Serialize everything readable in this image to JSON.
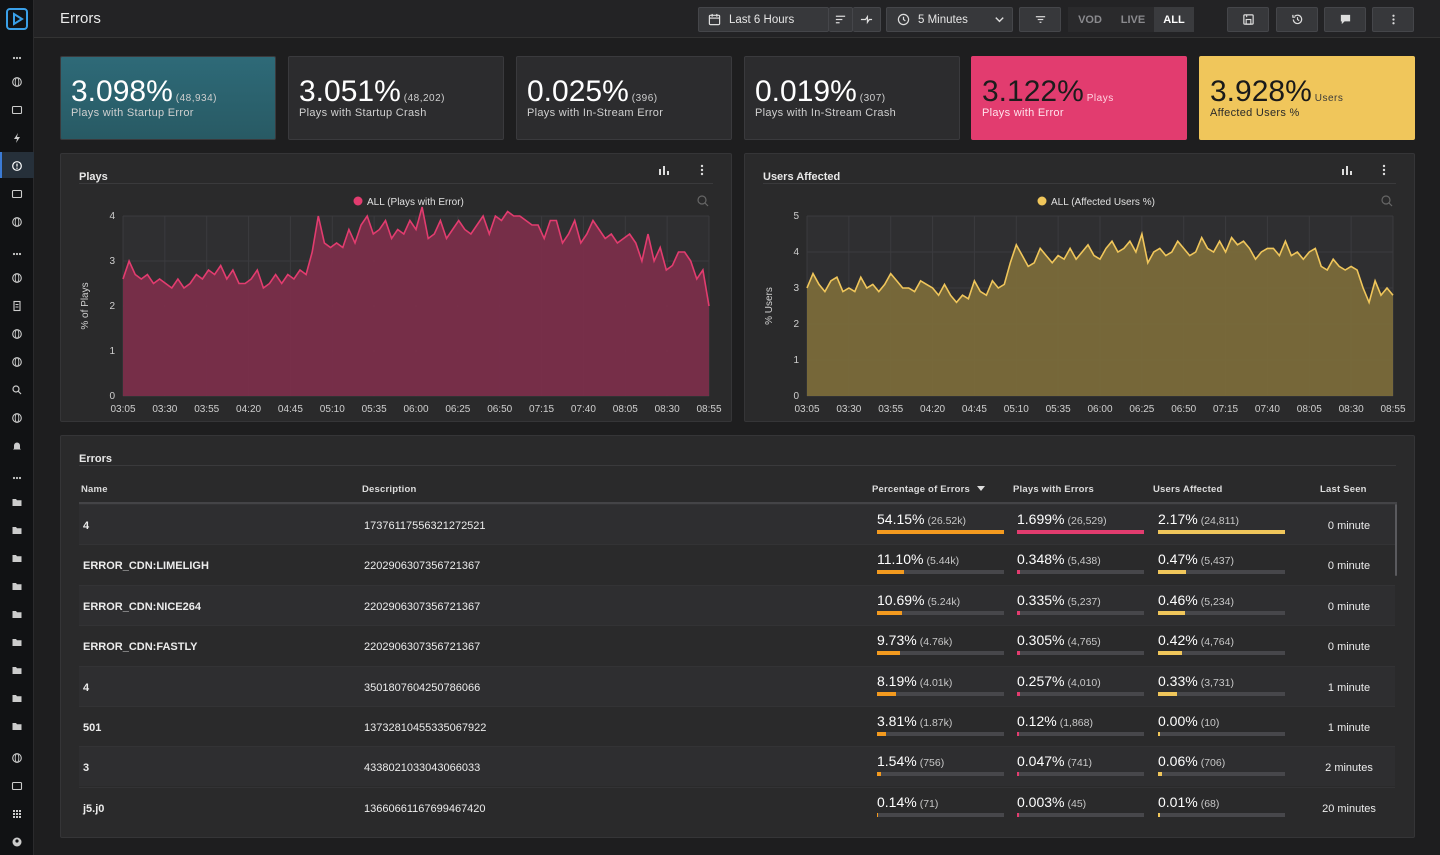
{
  "header": {
    "title": "Errors",
    "time_range": "Last 6 Hours",
    "interval": "5 Minutes",
    "modes": [
      "VOD",
      "LIVE",
      "ALL"
    ],
    "active_mode": "ALL"
  },
  "colors": {
    "accent": "#3b7bd6",
    "plays": "#e23c6f",
    "users": "#f0c65b",
    "bar_orange": "#f39a1f"
  },
  "kpis": [
    {
      "value": "3.098%",
      "count": "(48,934)",
      "label": "Plays with Startup Error",
      "bg": "#2c5f6a"
    },
    {
      "value": "3.051%",
      "count": "(48,202)",
      "label": "Plays with Startup Crash",
      "bg": "#2c2c2e"
    },
    {
      "value": "0.025%",
      "count": "(396)",
      "label": "Plays with In-Stream Error",
      "bg": "#2c2c2e"
    },
    {
      "value": "0.019%",
      "count": "(307)",
      "label": "Plays with In-Stream Crash",
      "bg": "#2c2c2e"
    },
    {
      "value": "3.122%",
      "count": "Plays",
      "label": "Plays with Error",
      "bg": "#e23c6f"
    },
    {
      "value": "3.928%",
      "count": "Users",
      "label": "Affected Users %",
      "bg": "#f0c65b"
    }
  ],
  "chart_data": [
    {
      "type": "area",
      "title": "Plays",
      "ylabel": "% of Plays",
      "legend": "ALL (Plays with Error)",
      "legend_position": "top-center",
      "color": "#e23c6f",
      "ylim": [
        0,
        4
      ],
      "yticks": [
        0,
        1,
        2,
        3,
        4
      ],
      "x_ticks": [
        "03:05",
        "03:30",
        "03:55",
        "04:20",
        "04:45",
        "05:10",
        "05:35",
        "06:00",
        "06:25",
        "06:50",
        "07:15",
        "07:40",
        "08:05",
        "08:30",
        "08:55"
      ],
      "values": [
        2.6,
        3.0,
        2.7,
        2.6,
        2.7,
        2.5,
        2.6,
        2.5,
        2.4,
        2.6,
        2.4,
        2.5,
        2.7,
        2.6,
        2.8,
        2.7,
        2.9,
        2.6,
        2.8,
        2.5,
        2.5,
        2.6,
        2.8,
        2.4,
        2.5,
        2.7,
        2.5,
        2.7,
        2.6,
        2.8,
        2.7,
        3.2,
        4.0,
        3.4,
        3.3,
        3.4,
        3.3,
        3.7,
        3.4,
        3.8,
        4.0,
        3.6,
        3.7,
        3.9,
        3.5,
        3.7,
        3.6,
        3.9,
        3.7,
        4.2,
        3.5,
        3.6,
        3.9,
        3.5,
        3.7,
        3.9,
        3.7,
        3.6,
        3.8,
        4.0,
        3.6,
        4.0,
        3.9,
        4.1,
        4.0,
        4.0,
        3.9,
        3.8,
        3.8,
        3.5,
        3.9,
        3.9,
        3.4,
        3.6,
        3.9,
        3.4,
        3.6,
        3.9,
        3.7,
        3.5,
        3.6,
        3.4,
        3.5,
        3.6,
        3.4,
        3.0,
        3.6,
        3.0,
        3.3,
        2.8,
        2.9,
        3.2,
        3.2,
        3.0,
        2.6,
        2.8,
        2.0
      ]
    },
    {
      "type": "area",
      "title": "Users Affected",
      "ylabel": "% Users",
      "legend": "ALL (Affected Users %)",
      "legend_position": "top-center",
      "color": "#f0c65b",
      "ylim": [
        0,
        5
      ],
      "yticks": [
        0,
        1,
        2,
        3,
        4,
        5
      ],
      "x_ticks": [
        "03:05",
        "03:30",
        "03:55",
        "04:20",
        "04:45",
        "05:10",
        "05:35",
        "06:00",
        "06:25",
        "06:50",
        "07:15",
        "07:40",
        "08:05",
        "08:30",
        "08:55"
      ],
      "values": [
        3.0,
        3.4,
        3.1,
        2.9,
        3.2,
        3.3,
        2.9,
        3.0,
        2.9,
        3.3,
        3.0,
        3.1,
        2.9,
        3.1,
        3.4,
        3.2,
        3.0,
        3.0,
        2.9,
        3.2,
        3.1,
        3.0,
        2.8,
        3.1,
        2.8,
        2.6,
        2.8,
        2.7,
        3.2,
        2.9,
        2.8,
        3.2,
        3.0,
        3.1,
        3.7,
        4.2,
        3.9,
        3.6,
        3.7,
        4.1,
        3.9,
        3.7,
        3.9,
        3.8,
        4.1,
        3.8,
        4.0,
        4.2,
        3.9,
        3.8,
        4.1,
        4.3,
        4.0,
        4.1,
        4.3,
        4.0,
        4.5,
        3.7,
        4.0,
        4.1,
        3.9,
        4.0,
        4.3,
        4.1,
        3.9,
        4.0,
        4.4,
        4.1,
        4.0,
        4.3,
        4.0,
        4.4,
        4.2,
        4.3,
        4.1,
        3.8,
        4.0,
        4.1,
        4.1,
        3.9,
        4.3,
        3.9,
        4.0,
        3.8,
        4.0,
        4.1,
        3.6,
        3.5,
        3.8,
        3.6,
        3.5,
        3.6,
        3.5,
        3.0,
        2.6,
        3.2,
        2.8,
        3.0,
        2.8
      ]
    }
  ],
  "table": {
    "title": "Errors",
    "columns": [
      "Name",
      "Description",
      "Percentage of Errors",
      "Plays with Errors",
      "Users Affected",
      "Last Seen"
    ],
    "rows": [
      {
        "name": "4",
        "desc": "17376117556321272521",
        "pct": "54.15%",
        "pct_count": "(26.52k)",
        "pct_frac": 1.0,
        "plays": "1.699%",
        "plays_count": "(26,529)",
        "plays_frac": 1.0,
        "users": "2.17%",
        "users_count": "(24,811)",
        "users_frac": 1.0,
        "last": "0 minute"
      },
      {
        "name": "ERROR_CDN:LIMELIGH",
        "desc": "2202906307356721367",
        "pct": "11.10%",
        "pct_count": "(5.44k)",
        "pct_frac": 0.21,
        "plays": "0.348%",
        "plays_count": "(5,438)",
        "plays_frac": 0.02,
        "users": "0.47%",
        "users_count": "(5,437)",
        "users_frac": 0.22,
        "last": "0 minute"
      },
      {
        "name": "ERROR_CDN:NICE264",
        "desc": "2202906307356721367",
        "pct": "10.69%",
        "pct_count": "(5.24k)",
        "pct_frac": 0.2,
        "plays": "0.335%",
        "plays_count": "(5,237)",
        "plays_frac": 0.02,
        "users": "0.46%",
        "users_count": "(5,234)",
        "users_frac": 0.21,
        "last": "0 minute"
      },
      {
        "name": "ERROR_CDN:FASTLY",
        "desc": "2202906307356721367",
        "pct": "9.73%",
        "pct_count": "(4.76k)",
        "pct_frac": 0.18,
        "plays": "0.305%",
        "plays_count": "(4,765)",
        "plays_frac": 0.02,
        "users": "0.42%",
        "users_count": "(4,764)",
        "users_frac": 0.19,
        "last": "0 minute"
      },
      {
        "name": "4",
        "desc": "3501807604250786066",
        "pct": "8.19%",
        "pct_count": "(4.01k)",
        "pct_frac": 0.15,
        "plays": "0.257%",
        "plays_count": "(4,010)",
        "plays_frac": 0.02,
        "users": "0.33%",
        "users_count": "(3,731)",
        "users_frac": 0.15,
        "last": "1 minute"
      },
      {
        "name": "501",
        "desc": "13732810455335067922",
        "pct": "3.81%",
        "pct_count": "(1.87k)",
        "pct_frac": 0.07,
        "plays": "0.12%",
        "plays_count": "(1,868)",
        "plays_frac": 0.01,
        "users": "0.00%",
        "users_count": "(10)",
        "users_frac": 0.0,
        "last": "1 minute"
      },
      {
        "name": "3",
        "desc": "4338021033043066033",
        "pct": "1.54%",
        "pct_count": "(756)",
        "pct_frac": 0.03,
        "plays": "0.047%",
        "plays_count": "(741)",
        "plays_frac": 0.0,
        "users": "0.06%",
        "users_count": "(706)",
        "users_frac": 0.03,
        "last": "2 minutes"
      },
      {
        "name": "j5.j0",
        "desc": "13660661167699467420",
        "pct": "0.14%",
        "pct_count": "(71)",
        "pct_frac": 0.003,
        "plays": "0.003%",
        "plays_count": "(45)",
        "plays_frac": 0.0,
        "users": "0.01%",
        "users_count": "(68)",
        "users_frac": 0.0,
        "last": "20 minutes"
      }
    ]
  }
}
